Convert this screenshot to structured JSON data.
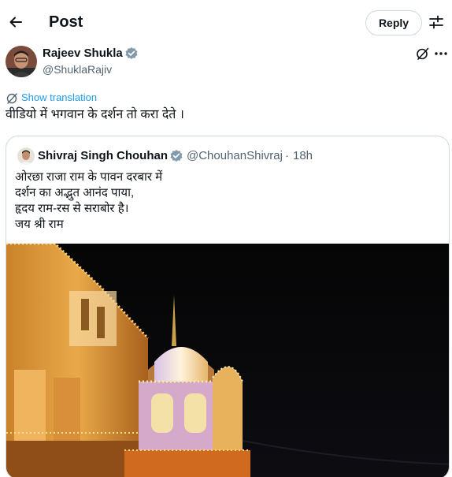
{
  "header": {
    "title": "Post",
    "reply_label": "Reply",
    "back_icon": "arrow-left-icon",
    "tune_icon": "sliders-icon"
  },
  "post": {
    "author_name": "Rajeev Shukla",
    "author_handle": "@ShuklaRajiv",
    "verified": true,
    "show_translation": "Show translation",
    "text": "वीडियो में भगवान के दर्शन तो करा देते ।"
  },
  "quote": {
    "author_name": "Shivraj Singh Chouhan",
    "author_handle": "@ChouhanShivraj",
    "separator": "·",
    "time": "18h",
    "verified": true,
    "lines": [
      "ओरछा राजा राम के पावन दरबार में",
      "दर्शन का अद्भुत आनंद पाया,",
      "हृदय राम-रस से सराबोर है।",
      "जय श्री राम"
    ],
    "media": "temple-night-photo"
  },
  "colors": {
    "text": "#0f1419",
    "secondary": "#536471",
    "accent": "#1d9bf0",
    "border": "#cfd9de"
  }
}
